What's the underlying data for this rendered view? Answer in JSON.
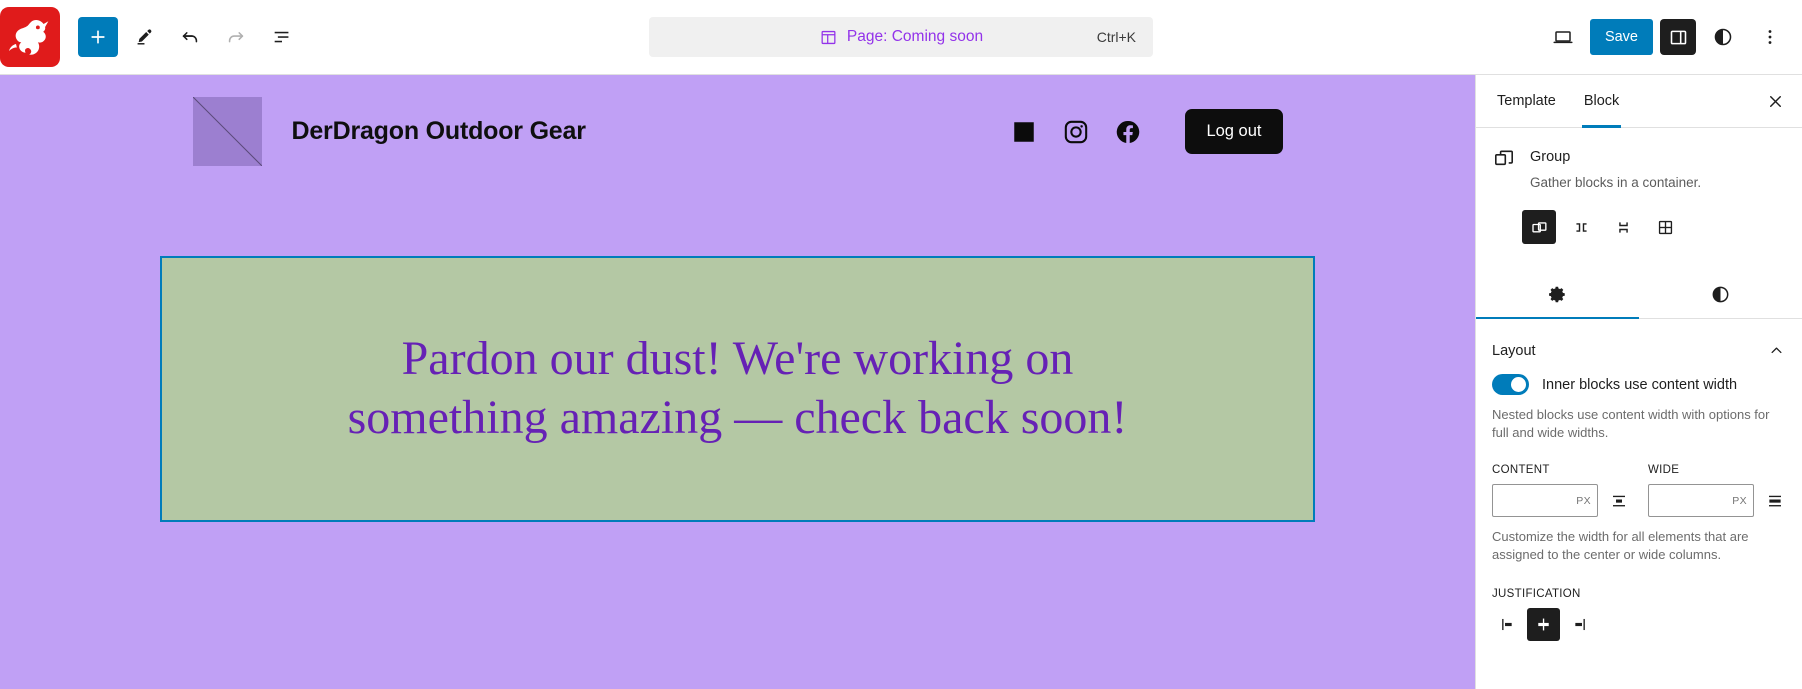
{
  "topbar": {
    "site_icon_name": "dragon-logo",
    "tools": [
      {
        "name": "add-block-button",
        "icon": "plus-icon",
        "label": "Add block"
      },
      {
        "name": "edit-tool-button",
        "icon": "pencil-icon",
        "label": "Edit"
      },
      {
        "name": "undo-button",
        "icon": "undo-icon",
        "label": "Undo"
      },
      {
        "name": "redo-button",
        "icon": "redo-icon",
        "label": "Redo"
      },
      {
        "name": "list-view-button",
        "icon": "list-view-icon",
        "label": "Document Overview"
      }
    ],
    "command_bar": {
      "icon": "template-icon",
      "label": "Page: Coming soon",
      "shortcut": "Ctrl+K"
    },
    "right": {
      "preview_label": "View",
      "save_label": "Save",
      "sidebar_toggle_label": "Settings",
      "styles_label": "Styles",
      "options_label": "Options"
    },
    "accent_color": "#007cba",
    "command_label_color": "#9333ea"
  },
  "canvas": {
    "background_color": "#c0a0f5",
    "site_header": {
      "logo_name": "site-logo-placeholder",
      "title": "DerDragon Outdoor Gear",
      "social_links": [
        {
          "name": "linkedin-icon",
          "label": "LinkedIn"
        },
        {
          "name": "instagram-icon",
          "label": "Instagram"
        },
        {
          "name": "facebook-icon",
          "label": "Facebook"
        }
      ],
      "logout_label": "Log out"
    },
    "content_block": {
      "background_color": "#b4c8a4",
      "selection_color": "#007cba",
      "text": "Pardon our dust! We're working on something amazing — check back soon!",
      "text_color": "#6621b5"
    }
  },
  "sidebar": {
    "tabs": [
      {
        "label": "Template",
        "active": false
      },
      {
        "label": "Block",
        "active": true
      }
    ],
    "close_label": "Close Settings",
    "block": {
      "icon": "group-icon",
      "title": "Group",
      "description": "Gather blocks in a container.",
      "variations": [
        {
          "name": "variation-group",
          "label": "Group",
          "active": true
        },
        {
          "name": "variation-row",
          "label": "Row",
          "active": false
        },
        {
          "name": "variation-stack",
          "label": "Stack",
          "active": false
        },
        {
          "name": "variation-grid",
          "label": "Grid",
          "active": false
        }
      ]
    },
    "inspector_tabs": [
      {
        "name": "tab-settings",
        "icon": "gear-icon",
        "active": true
      },
      {
        "name": "tab-styles",
        "icon": "contrast-icon",
        "active": false
      }
    ],
    "layout_panel": {
      "title": "Layout",
      "toggle": {
        "label": "Inner blocks use content width",
        "on": true
      },
      "help_text": "Nested blocks use content width with options for full and wide widths.",
      "content": {
        "label": "Content",
        "value": "",
        "unit": "PX",
        "align_name": "content-width-align-icon"
      },
      "wide": {
        "label": "Wide",
        "value": "",
        "unit": "PX",
        "align_name": "wide-width-align-icon"
      },
      "width_help_text": "Customize the width for all elements that are assigned to the center or wide columns.",
      "justification": {
        "label": "Justification",
        "options": [
          {
            "name": "justify-left-button",
            "label": "Justify items left",
            "active": false
          },
          {
            "name": "justify-center-button",
            "label": "Justify items center",
            "active": true
          },
          {
            "name": "justify-right-button",
            "label": "Justify items right",
            "active": false
          }
        ]
      }
    }
  }
}
